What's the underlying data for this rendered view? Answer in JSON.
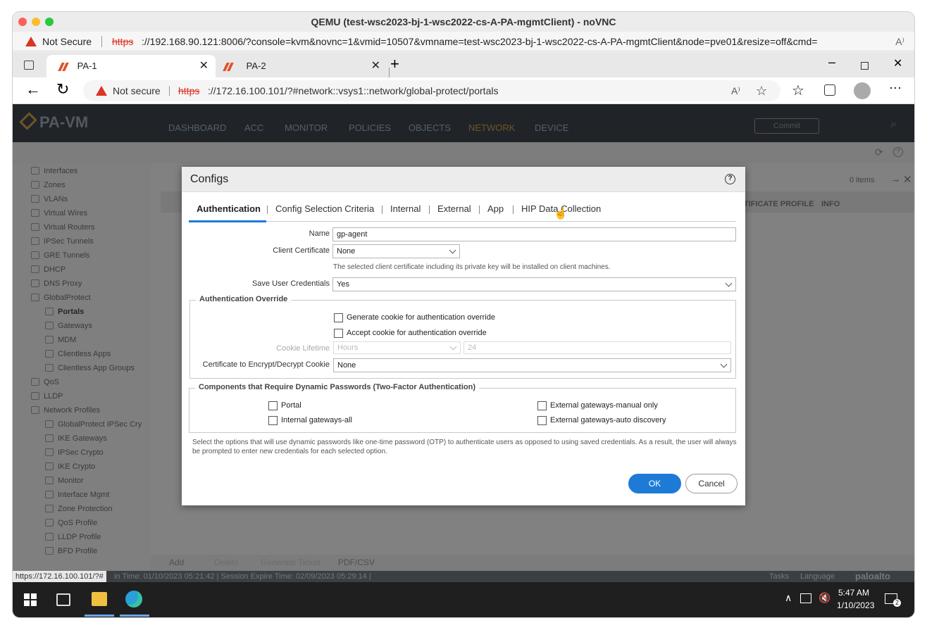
{
  "mac_title": "QEMU (test-wsc2023-bj-1-wsc2022-cs-A-PA-mgmtClient) - noVNC",
  "mac_url": {
    "warning": "Not Secure",
    "scheme": "https",
    "rest": "://192.168.90.121:8006/?console=kvm&novnc=1&vmid=10507&vmname=test-wsc2023-bj-1-wsc2022-cs-A-PA-mgmtClient&node=pve01&resize=off&cmd="
  },
  "browser": {
    "tabs": [
      {
        "label": "PA-1"
      },
      {
        "label": "PA-2"
      }
    ],
    "address": {
      "warning": "Not secure",
      "scheme": "https",
      "rest": "://172.16.100.101/?#network::vsys1::network/global-protect/portals"
    }
  },
  "pan": {
    "logo": "PA-VM",
    "nav": [
      "DASHBOARD",
      "ACC",
      "MONITOR",
      "POLICIES",
      "OBJECTS",
      "NETWORK",
      "DEVICE"
    ],
    "commit": "Commit",
    "items_count": "0 items",
    "columns": [
      "TIFICATE PROFILE",
      "INFO"
    ],
    "sidebar": [
      "Interfaces",
      "Zones",
      "VLANs",
      "Virtual Wires",
      "Virtual Routers",
      "IPSec Tunnels",
      "GRE Tunnels",
      "DHCP",
      "DNS Proxy",
      "GlobalProtect",
      "Portals",
      "Gateways",
      "MDM",
      "Clientless Apps",
      "Clientless App Groups",
      "QoS",
      "LLDP",
      "Network Profiles",
      "GlobalProtect IPSec Cry",
      "IKE Gateways",
      "IPSec Crypto",
      "IKE Crypto",
      "Monitor",
      "Interface Mgmt",
      "Zone Protection",
      "QoS Profile",
      "LLDP Profile",
      "BFD Profile"
    ],
    "bottom_actions": [
      "Add",
      "Delete",
      "Generate Ticket",
      "PDF/CSV"
    ],
    "status_text": "in Time: 01/10/2023 05:21:42 | Session Expire Time: 02/09/2023 05:29:14 |",
    "status_right": [
      "Tasks",
      "Language"
    ],
    "brand": "paloalto",
    "link_tip": "https://172.16.100.101/?#"
  },
  "dialog": {
    "title": "Configs",
    "help": "?",
    "tabs": [
      "Authentication",
      "Config Selection Criteria",
      "Internal",
      "External",
      "App",
      "HIP Data Collection"
    ],
    "name_label": "Name",
    "name_value": "gp-agent",
    "client_cert_label": "Client Certificate",
    "client_cert_value": "None",
    "client_cert_note": "The selected client certificate including its private key will be installed on client machines.",
    "save_cred_label": "Save User Credentials",
    "save_cred_value": "Yes",
    "auth_override_title": "Authentication Override",
    "gen_cookie": "Generate cookie for authentication override",
    "accept_cookie": "Accept cookie for authentication override",
    "cookie_lifetime_label": "Cookie Lifetime",
    "cookie_unit": "Hours",
    "cookie_value": "24",
    "cert_encrypt_label": "Certificate to Encrypt/Decrypt Cookie",
    "cert_encrypt_value": "None",
    "dyn_title": "Components that Require Dynamic Passwords (Two-Factor Authentication)",
    "portal": "Portal",
    "internal_all": "Internal gateways-all",
    "ext_manual": "External gateways-manual only",
    "ext_auto": "External gateways-auto discovery",
    "dyn_note": "Select the options that will use dynamic passwords like one-time password (OTP) to authenticate users as opposed to using saved credentials. As a result, the user will always be prompted to enter new credentials for each selected option.",
    "ok": "OK",
    "cancel": "Cancel"
  },
  "taskbar": {
    "time": "5:47 AM",
    "date": "1/10/2023",
    "notif": "2"
  }
}
